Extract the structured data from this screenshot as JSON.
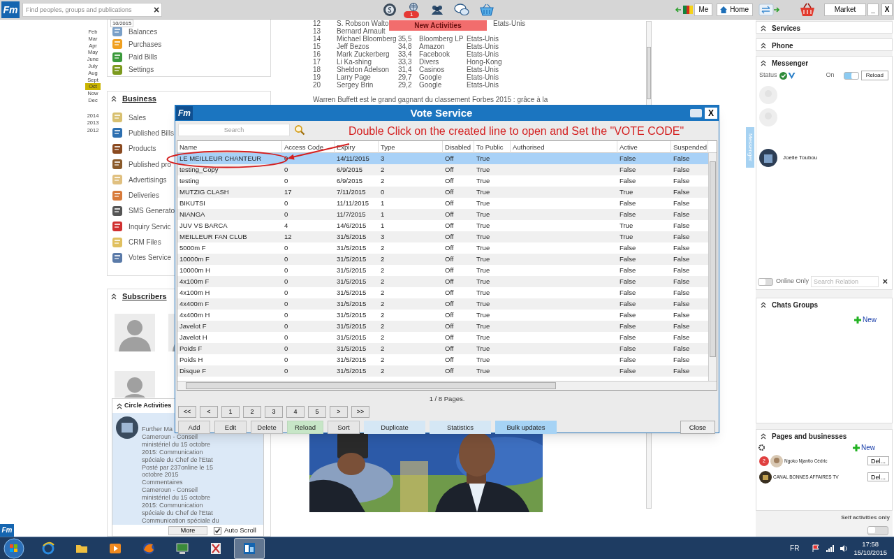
{
  "top_bar": {
    "logo": "Fm",
    "search": {
      "placeholder": "Find peoples, groups and publications"
    },
    "clear": "×",
    "notification_count": "1",
    "me_button": "Me",
    "home_button": "Home",
    "market_button": "Market",
    "minimize": "_",
    "close": "X"
  },
  "calendar": {
    "tooltip": "10/2015",
    "months": [
      {
        "label": "Feb",
        "selected": false
      },
      {
        "label": "Mar",
        "selected": false
      },
      {
        "label": "Apr",
        "selected": false
      },
      {
        "label": "May",
        "selected": false
      },
      {
        "label": "June",
        "selected": false
      },
      {
        "label": "July",
        "selected": false
      },
      {
        "label": "Aug",
        "selected": false
      },
      {
        "label": "Sept",
        "selected": false
      },
      {
        "label": "Oct",
        "selected": true
      },
      {
        "label": "Now",
        "selected": false
      },
      {
        "label": "Dec",
        "selected": false
      }
    ],
    "years": [
      "2014",
      "2013",
      "2012"
    ]
  },
  "account_menu": {
    "items": [
      "Balances",
      "Purchases",
      "Paid Bills",
      "Settings"
    ]
  },
  "business": {
    "title": "Business",
    "items": [
      "Sales",
      "Published Bills",
      "Products",
      "Published pro",
      "Advertisings",
      "Deliveries",
      "SMS Generato",
      "Inquiry Servic",
      "CRM Files",
      "Votes Service"
    ]
  },
  "subscribers": {
    "title": "Subscribers"
  },
  "news": {
    "banner": "New Activities",
    "rows": [
      {
        "rank": "12",
        "name": "S. Robson Walto",
        "country": "Etats-Unis"
      },
      {
        "rank": "13",
        "name": "Bernard Arnault"
      },
      {
        "rank": "14",
        "name": "Michael Bloomberg",
        "worth": "35,5",
        "company": "Bloomberg LP",
        "country": "Etats-Unis"
      },
      {
        "rank": "15",
        "name": "Jeff Bezos",
        "worth": "34,8",
        "company": "Amazon",
        "country": "Etats-Unis"
      },
      {
        "rank": "16",
        "name": "Mark Zuckerberg",
        "worth": "33,4",
        "company": "Facebook",
        "country": "Etats-Unis"
      },
      {
        "rank": "17",
        "name": "Li Ka-shing",
        "worth": "33,3",
        "company": "Divers",
        "country": "Hong-Kong"
      },
      {
        "rank": "18",
        "name": "Sheldon Adelson",
        "worth": "31,4",
        "company": "Casinos",
        "country": "Etats-Unis"
      },
      {
        "rank": "19",
        "name": "Larry Page",
        "worth": "29,7",
        "company": "Google",
        "country": "Etats-Unis"
      },
      {
        "rank": "20",
        "name": "Sergey Brin",
        "worth": "29,2",
        "company": "Google",
        "country": "Etats-Unis"
      }
    ],
    "paragraph": "Warren Buffett est le grand gagnant du classement Forbes 2015 : grâce à la"
  },
  "circle_activities": {
    "title": "Circle Activities",
    "headline": "Further Ma",
    "lines": [
      "Cameroun - Conseil",
      "ministériel du 15 octobre",
      "2015: Communication",
      "spéciale du Chef de l'Etat",
      "Posté par 237online le 15",
      "octobre 2015",
      "Commentaires",
      "Cameroun - Conseil",
      "ministériel du 15 octobre",
      "2015: Communication",
      "spéciale du Chef de l'Etat",
      "Communication spéciale du"
    ],
    "more_button": "More",
    "auto_scroll": {
      "label": "Auto Scroll",
      "checked": true
    }
  },
  "dialog": {
    "logo": "Fm",
    "title": "Vote Service",
    "search": {
      "placeholder": "Search"
    },
    "annotation": "Double Click on the created line to open and Set the \"VOTE CODE\"",
    "close_x": "X",
    "table": {
      "columns": [
        "Name",
        "Access Code",
        "Expiry",
        "Type",
        "Disabled",
        "To Public",
        "Authorised",
        "Active",
        "Suspended"
      ],
      "rows": [
        {
          "selected": true,
          "cells": [
            "LE MEILLEUR CHANTEUR",
            "0",
            "14/11/2015",
            "3",
            "Off",
            "True",
            "",
            "False",
            "False"
          ]
        },
        {
          "selected": false,
          "cells": [
            "testing_Copy",
            "0",
            "6/9/2015",
            "2",
            "Off",
            "True",
            "",
            "False",
            "False"
          ]
        },
        {
          "selected": false,
          "cells": [
            "testing",
            "0",
            "6/9/2015",
            "2",
            "Off",
            "True",
            "",
            "False",
            "False"
          ]
        },
        {
          "selected": false,
          "cells": [
            "MUTZIG CLASH",
            "17",
            "7/11/2015",
            "0",
            "Off",
            "True",
            "",
            "True",
            "False"
          ]
        },
        {
          "selected": false,
          "cells": [
            "BIKUTSI",
            "0",
            "11/11/2015",
            "1",
            "Off",
            "True",
            "",
            "False",
            "False"
          ]
        },
        {
          "selected": false,
          "cells": [
            "NIANGA",
            "0",
            "11/7/2015",
            "1",
            "Off",
            "True",
            "",
            "False",
            "False"
          ]
        },
        {
          "selected": false,
          "cells": [
            "JUV VS BARCA",
            "4",
            "14/6/2015",
            "1",
            "Off",
            "True",
            "",
            "True",
            "False"
          ]
        },
        {
          "selected": false,
          "cells": [
            "MEILLEUR FAN CLUB",
            "12",
            "31/5/2015",
            "3",
            "Off",
            "True",
            "",
            "True",
            "False"
          ]
        },
        {
          "selected": false,
          "cells": [
            "5000m F",
            "0",
            "31/5/2015",
            "2",
            "Off",
            "True",
            "",
            "False",
            "False"
          ]
        },
        {
          "selected": false,
          "cells": [
            "10000m F",
            "0",
            "31/5/2015",
            "2",
            "Off",
            "True",
            "",
            "False",
            "False"
          ]
        },
        {
          "selected": false,
          "cells": [
            "10000m H",
            "0",
            "31/5/2015",
            "2",
            "Off",
            "True",
            "",
            "False",
            "False"
          ]
        },
        {
          "selected": false,
          "cells": [
            "4x100m F",
            "0",
            "31/5/2015",
            "2",
            "Off",
            "True",
            "",
            "False",
            "False"
          ]
        },
        {
          "selected": false,
          "cells": [
            "4x100m H",
            "0",
            "31/5/2015",
            "2",
            "Off",
            "True",
            "",
            "False",
            "False"
          ]
        },
        {
          "selected": false,
          "cells": [
            "4x400m F",
            "0",
            "31/5/2015",
            "2",
            "Off",
            "True",
            "",
            "False",
            "False"
          ]
        },
        {
          "selected": false,
          "cells": [
            "4x400m H",
            "0",
            "31/5/2015",
            "2",
            "Off",
            "True",
            "",
            "False",
            "False"
          ]
        },
        {
          "selected": false,
          "cells": [
            "Javelot F",
            "0",
            "31/5/2015",
            "2",
            "Off",
            "True",
            "",
            "False",
            "False"
          ]
        },
        {
          "selected": false,
          "cells": [
            "Javelot H",
            "0",
            "31/5/2015",
            "2",
            "Off",
            "True",
            "",
            "False",
            "False"
          ]
        },
        {
          "selected": false,
          "cells": [
            "Poids F",
            "0",
            "31/5/2015",
            "2",
            "Off",
            "True",
            "",
            "False",
            "False"
          ]
        },
        {
          "selected": false,
          "cells": [
            "Poids H",
            "0",
            "31/5/2015",
            "2",
            "Off",
            "True",
            "",
            "False",
            "False"
          ]
        },
        {
          "selected": false,
          "cells": [
            "Disque F",
            "0",
            "31/5/2015",
            "2",
            "Off",
            "True",
            "",
            "False",
            "False"
          ]
        }
      ]
    },
    "page_info": "1 / 8 Pages.",
    "pager": [
      "<<",
      "<",
      "1",
      "2",
      "3",
      "4",
      "5",
      ">",
      ">>"
    ],
    "actions": [
      {
        "label": "Add",
        "kind": "plain"
      },
      {
        "label": "Edit",
        "kind": "plain"
      },
      {
        "label": "Delete",
        "kind": "plain"
      },
      {
        "label": "Reload",
        "kind": "refresh"
      },
      {
        "label": "Sort",
        "kind": "plain"
      },
      {
        "label": "Duplicate",
        "kind": "tool"
      },
      {
        "label": "Statistics",
        "kind": "tool"
      },
      {
        "label": "Bulk updates",
        "kind": "bulk"
      }
    ],
    "close_button": "Close"
  },
  "right_panel": {
    "services": "Services",
    "phone": "Phone",
    "messenger": {
      "title": "Messenger",
      "tab": "Messenger",
      "status_label": "Status",
      "on_label": "On",
      "online": {
        "on": true
      },
      "reload": "Reload",
      "contacts": [
        {
          "name": "Joelle Toubou"
        }
      ],
      "online_only": {
        "label": "Online Only",
        "on": false
      },
      "search": {
        "placeholder": "Search Relation"
      },
      "clear": "×"
    },
    "chats_groups": {
      "title": "Chats Groups",
      "new": "New"
    },
    "pages": {
      "title": "Pages and businesses",
      "new": "New",
      "items": [
        {
          "name": "Ngoko Njantio Cédric",
          "badge": "2",
          "delete": "Del..."
        },
        {
          "name": "CANAL BONNES AFFAIRES TV",
          "delete": "Del..."
        }
      ]
    },
    "self_activities": {
      "label": "Self activities only",
      "on": false
    }
  },
  "footer_logo": "Fm",
  "taskbar": {
    "apps": [
      {
        "selected": false
      },
      {
        "selected": false
      },
      {
        "selected": false
      },
      {
        "selected": false
      },
      {
        "selected": false
      },
      {
        "selected": false
      },
      {
        "selected": true
      }
    ],
    "language": "FR",
    "time": "17:58",
    "date": "15/10/2015"
  }
}
